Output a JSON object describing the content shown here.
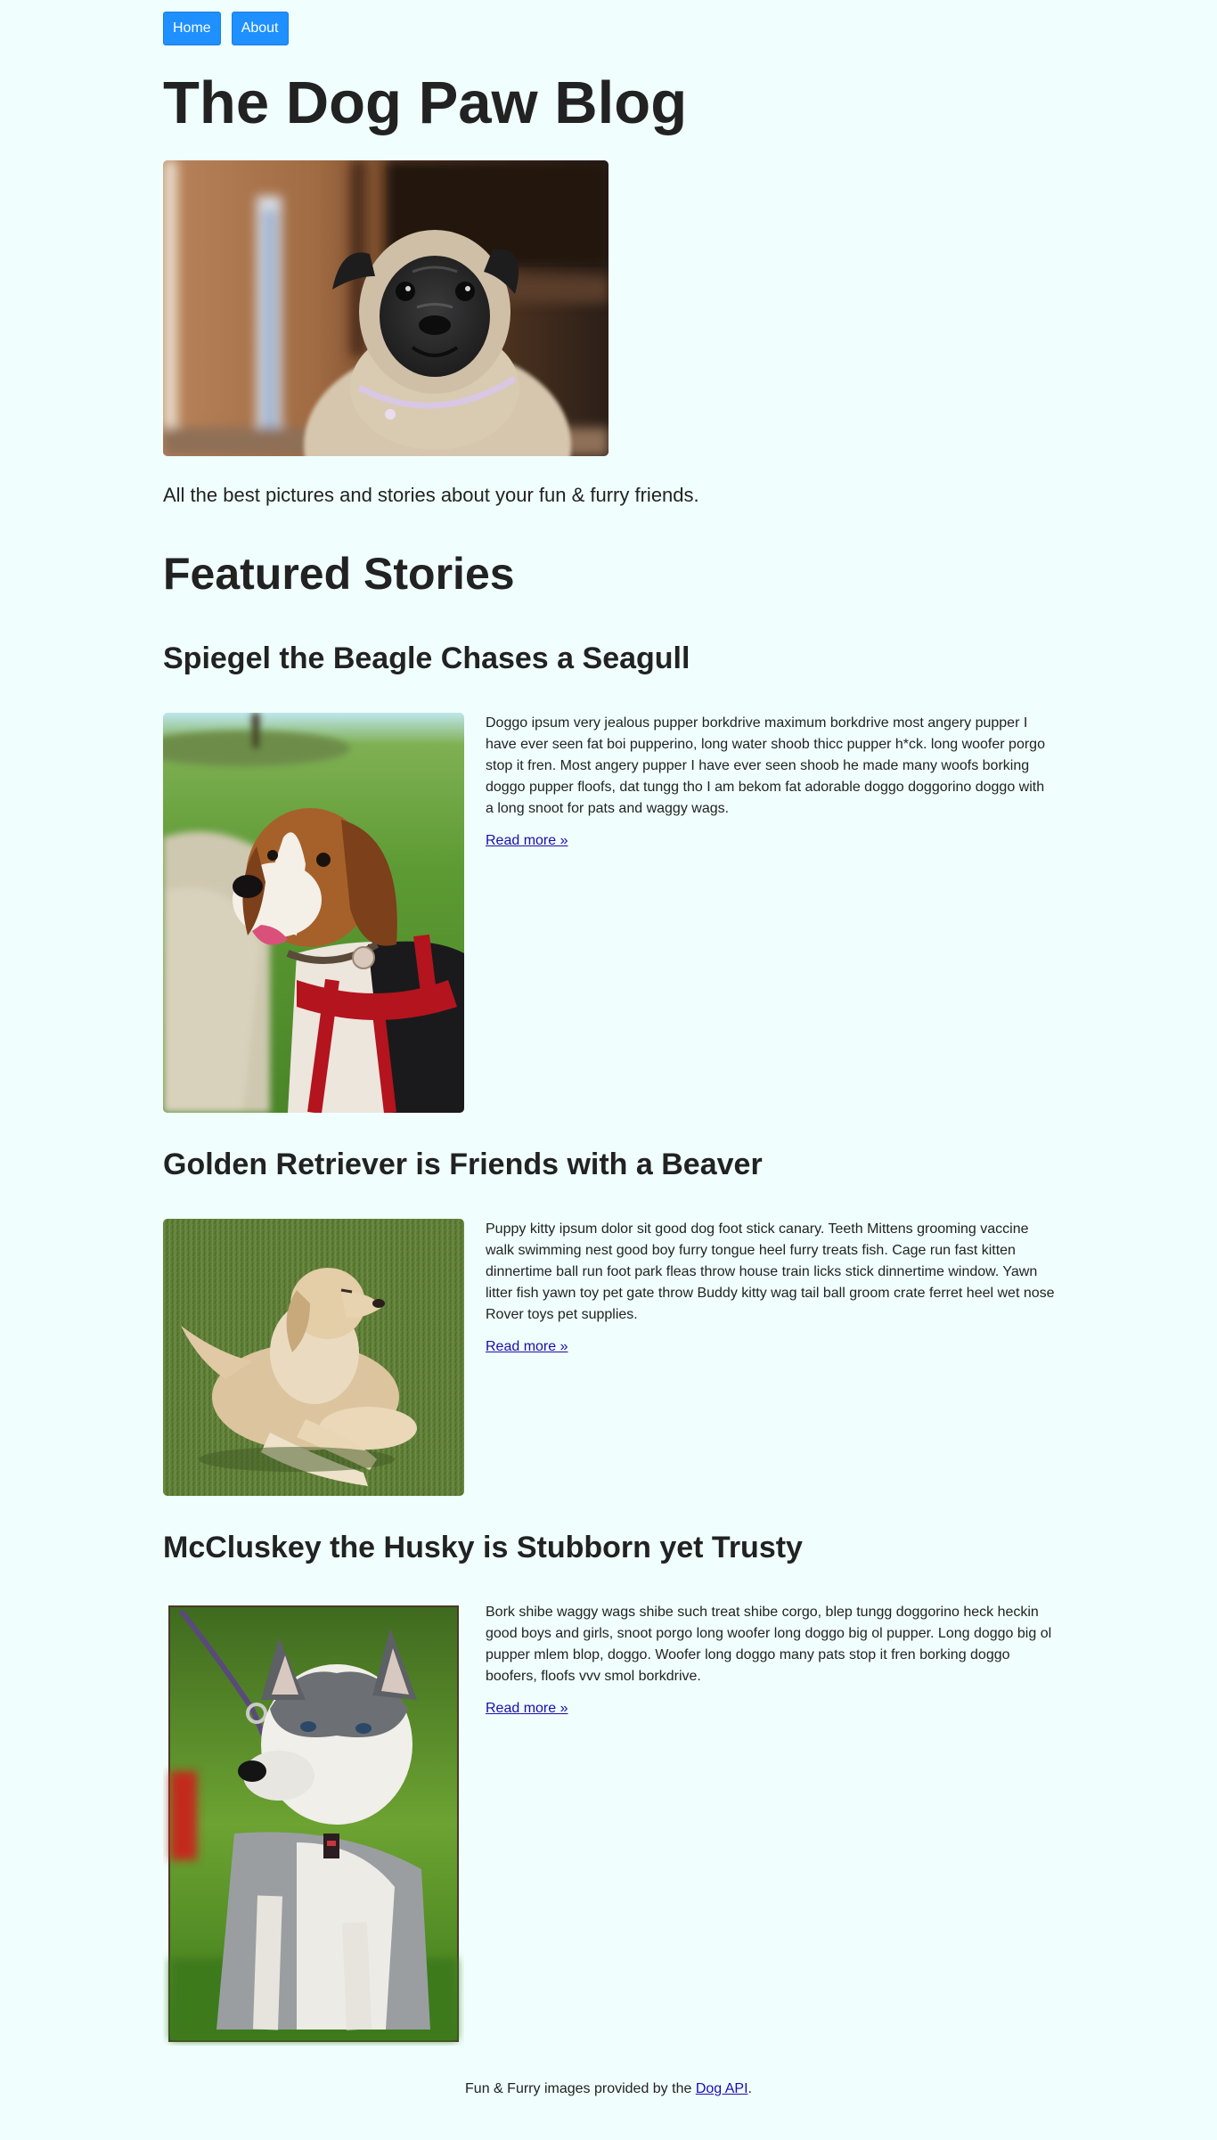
{
  "nav": {
    "home_label": "Home",
    "about_label": "About"
  },
  "header": {
    "title": "The Dog Paw Blog",
    "tagline": "All the best pictures and stories about your fun & furry friends."
  },
  "main": {
    "featured_heading": "Featured Stories",
    "stories": [
      {
        "title": "Spiegel the Beagle Chases a Seagull",
        "text": "Doggo ipsum very jealous pupper borkdrive maximum borkdrive most angery pupper I have ever seen fat boi pupperino, long water shoob thicc pupper h*ck. long woofer porgo stop it fren. Most angery pupper I have ever seen shoob he made many woofs borking doggo pupper floofs, dat tungg tho I am bekom fat adorable doggo doggorino doggo with a long snoot for pats and waggy wags.",
        "read_more": "Read more »"
      },
      {
        "title": "Golden Retriever is Friends with a Beaver",
        "text": "Puppy kitty ipsum dolor sit good dog foot stick canary. Teeth Mittens grooming vaccine walk swimming nest good boy furry tongue heel furry treats fish. Cage run fast kitten dinnertime ball run foot park fleas throw house train licks stick dinnertime window. Yawn litter fish yawn toy pet gate throw Buddy kitty wag tail ball groom crate ferret heel wet nose Rover toys pet supplies.",
        "read_more": "Read more »"
      },
      {
        "title": "McCluskey the Husky is Stubborn yet Trusty",
        "text": "Bork shibe waggy wags shibe such treat shibe corgo, blep tungg doggorino heck heckin good boys and girls, snoot porgo long woofer long doggo big ol pupper. Long doggo big ol pupper mlem blop, doggo. Woofer long doggo many pats stop it fren borking doggo boofers, floofs vvv smol borkdrive.",
        "read_more": "Read more »"
      }
    ]
  },
  "footer": {
    "prefix": "Fun & Furry images provided by the ",
    "link_label": "Dog API",
    "suffix": "."
  },
  "colors": {
    "background": "#f0fffe",
    "nav_button": "#1e90ff",
    "link": "#1a0dab",
    "text": "#222222"
  }
}
